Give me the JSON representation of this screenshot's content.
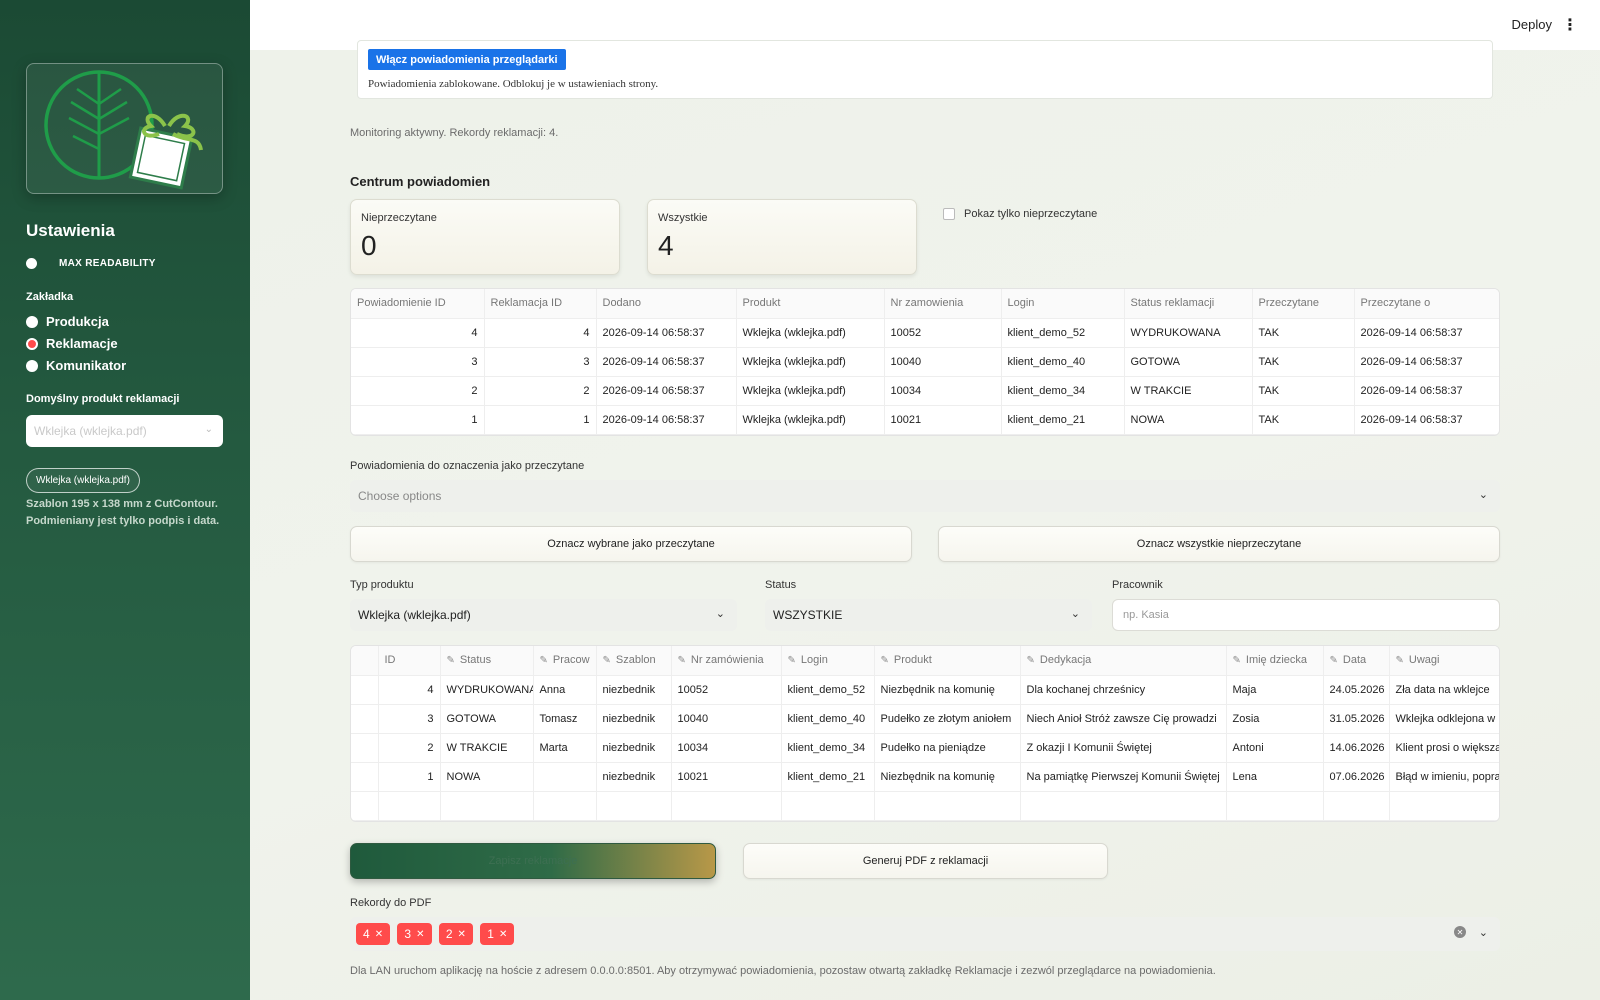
{
  "sidebar": {
    "title": "Ustawienia",
    "toggle_label": "MAX READABILITY",
    "tab_label": "Zakładka",
    "radios": [
      {
        "label": "Produkcja",
        "active": false
      },
      {
        "label": "Reklamacje",
        "active": true
      },
      {
        "label": "Komunikator",
        "active": false
      }
    ],
    "default_product_label": "Domyślny produkt reklamacji",
    "default_product_value": "Wklejka (wklejka.pdf)",
    "product_pill": "Wklejka (wklejka.pdf)",
    "product_desc": "Szablon 195 x 138 mm z CutContour. Podmieniany jest tylko podpis i data.",
    "logo_icon": "leaf-gift-logo"
  },
  "header": {
    "deploy_label": "Deploy",
    "menu_icon": "kebab-menu-icon"
  },
  "notifications_banner": {
    "button_label": "Włącz powiadomienia przeglądarki",
    "message": "Powiadomienia zablokowane. Odblokuj je w ustawieniach strony."
  },
  "monitoring_text": "Monitoring aktywny. Rekordy reklamacji: 4.",
  "notification_center": {
    "title": "Centrum powiadomien",
    "metrics": [
      {
        "label": "Nieprzeczytane",
        "value": "0"
      },
      {
        "label": "Wszystkie",
        "value": "4"
      }
    ],
    "unread_only_label": "Pokaz tylko nieprzeczytane",
    "table": {
      "headers": [
        "Powiadomienie ID",
        "Reklamacja ID",
        "Dodano",
        "Produkt",
        "Nr zamowienia",
        "Login",
        "Status reklamacji",
        "Przeczytane",
        "Przeczytane o"
      ],
      "rows": [
        [
          "4",
          "4",
          "2026-09-14 06:58:37",
          "Wklejka (wklejka.pdf)",
          "10052",
          "klient_demo_52",
          "WYDRUKOWANA",
          "TAK",
          "2026-09-14 06:58:37"
        ],
        [
          "3",
          "3",
          "2026-09-14 06:58:37",
          "Wklejka (wklejka.pdf)",
          "10040",
          "klient_demo_40",
          "GOTOWA",
          "TAK",
          "2026-09-14 06:58:37"
        ],
        [
          "2",
          "2",
          "2026-09-14 06:58:37",
          "Wklejka (wklejka.pdf)",
          "10034",
          "klient_demo_34",
          "W TRAKCIE",
          "TAK",
          "2026-09-14 06:58:37"
        ],
        [
          "1",
          "1",
          "2026-09-14 06:58:37",
          "Wklejka (wklejka.pdf)",
          "10021",
          "klient_demo_21",
          "NOWA",
          "TAK",
          "2026-09-14 06:58:37"
        ]
      ]
    },
    "mark_label": "Powiadomienia do oznaczenia jako przeczytane",
    "mark_placeholder": "Choose options",
    "mark_selected_button": "Oznacz wybrane jako przeczytane",
    "mark_all_button": "Oznacz wszystkie nieprzeczytane"
  },
  "filters": {
    "product_type_label": "Typ produktu",
    "product_type_value": "Wklejka (wklejka.pdf)",
    "status_label": "Status",
    "status_value": "WSZYSTKIE",
    "worker_label": "Pracownik",
    "worker_placeholder": "np. Kasia"
  },
  "complaints_table": {
    "headers": [
      "ID",
      "Status",
      "Pracow",
      "Szablon",
      "Nr zamówienia",
      "Login",
      "Produkt",
      "Dedykacja",
      "Imię dziecka",
      "Data",
      "Uwagi"
    ],
    "rows": [
      [
        "4",
        "WYDRUKOWANA",
        "Anna",
        "niezbednik",
        "10052",
        "klient_demo_52",
        "Niezbędnik na komunię",
        "Dla kochanej chrześnicy",
        "Maja",
        "24.05.2026",
        "Zła data na wklejce"
      ],
      [
        "3",
        "GOTOWA",
        "Tomasz",
        "niezbednik",
        "10040",
        "klient_demo_40",
        "Pudełko ze złotym aniołem",
        "Niech Anioł Stróż zawsze Cię prowadzi",
        "Zosia",
        "31.05.2026",
        "Wklejka odklejona w"
      ],
      [
        "2",
        "W TRAKCIE",
        "Marta",
        "niezbednik",
        "10034",
        "klient_demo_34",
        "Pudełko na pieniądze",
        "Z okazji I Komunii Świętej",
        "Antoni",
        "14.06.2026",
        "Klient prosi o większą"
      ],
      [
        "1",
        "NOWA",
        "",
        "niezbednik",
        "10021",
        "klient_demo_21",
        "Niezbędnik na komunię",
        "Na pamiątkę Pierwszej Komunii Świętej",
        "Lena",
        "07.06.2026",
        "Błąd w imieniu, popra"
      ]
    ]
  },
  "actions": {
    "save_button": "Zapisz reklamacje",
    "pdf_button": "Generuj PDF z reklamacji"
  },
  "pdf_records": {
    "label": "Rekordy do PDF",
    "tags": [
      "4",
      "3",
      "2",
      "1"
    ]
  },
  "footer_text": "Dla LAN uruchom aplikację na hoście z adresem 0.0.0.0:8501. Aby otrzymywać powiadomienia, pozostaw otwartą zakładkę Reklamacje i zezwól przeglądarce na powiadomienia.",
  "colors": {
    "sidebar_dark": "#1b4a34",
    "accent_red": "#ff4b4b",
    "notify_blue": "#1a73e8",
    "gold": "#b89848"
  }
}
